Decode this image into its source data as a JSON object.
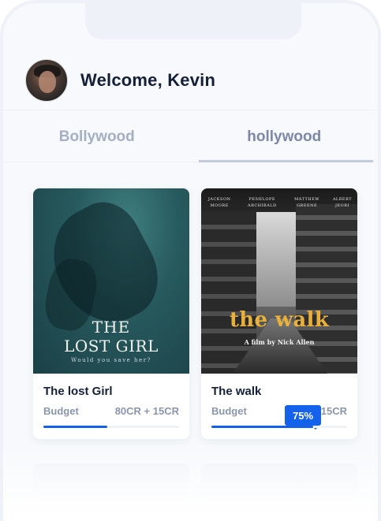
{
  "header": {
    "welcome": "Welcome, Kevin"
  },
  "tabs": [
    {
      "label": "Bollywood",
      "active": false
    },
    {
      "label": "hollywood",
      "active": true
    }
  ],
  "movies": [
    {
      "title": "The lost Girl",
      "budget_label": "Budget",
      "budget_value": "80CR + 15CR",
      "progress_percent": 47,
      "poster": {
        "title_line1": "THE",
        "title_line2": "LOST GIRL",
        "tagline": "Would you save her?"
      }
    },
    {
      "title": "The walk",
      "budget_label": "Budget",
      "budget_value": "15CR",
      "progress_percent": 75,
      "progress_badge": "75%",
      "poster": {
        "credits": [
          "JACKSON MOORE",
          "PENELOPE ARCHIBALD",
          "MATTHEW GREENE",
          "ALBERT JEORI"
        ],
        "title": "the walk",
        "tagline": "A film by Nick Allen"
      }
    }
  ],
  "colors": {
    "accent": "#1462ec",
    "text_dark": "#14203a",
    "muted": "#8a96ae"
  }
}
